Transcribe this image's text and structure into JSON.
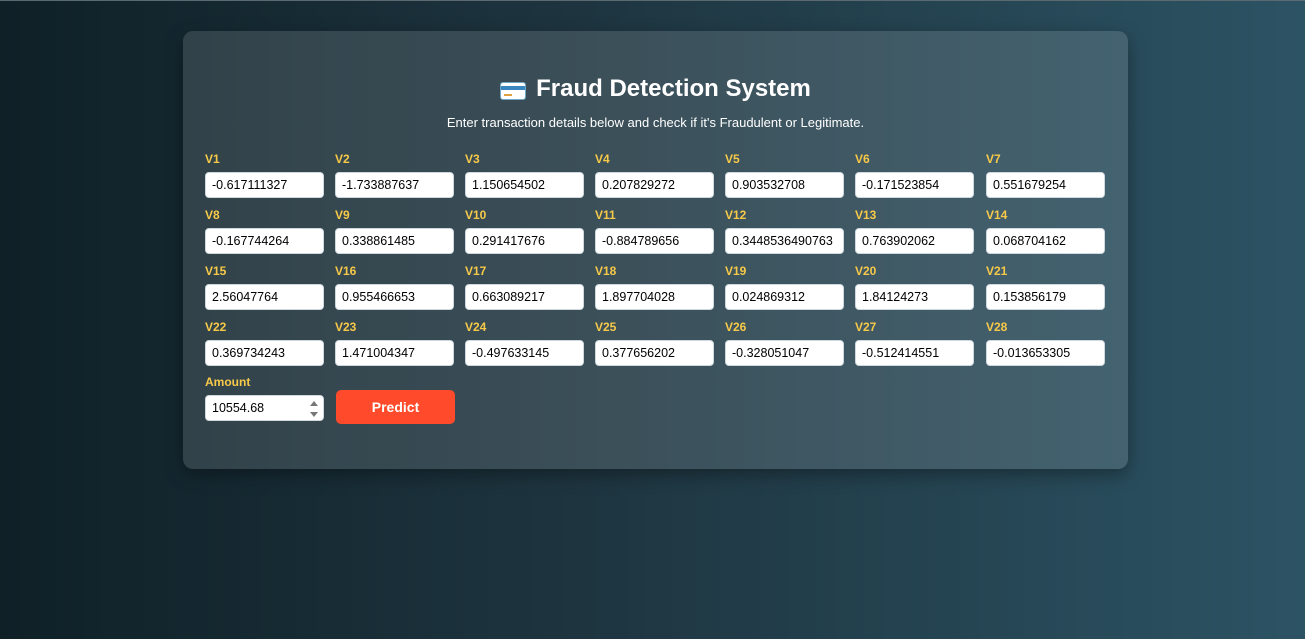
{
  "header": {
    "title": "Fraud Detection System",
    "icon": "credit-card-icon",
    "subtitle": "Enter transaction details below and check if it's Fraudulent or Legitimate."
  },
  "features": [
    {
      "label": "V1",
      "value": "-0.617111327"
    },
    {
      "label": "V2",
      "value": "-1.733887637"
    },
    {
      "label": "V3",
      "value": "1.150654502"
    },
    {
      "label": "V4",
      "value": "0.207829272"
    },
    {
      "label": "V5",
      "value": "0.903532708"
    },
    {
      "label": "V6",
      "value": "-0.171523854"
    },
    {
      "label": "V7",
      "value": "0.551679254"
    },
    {
      "label": "V8",
      "value": "-0.167744264"
    },
    {
      "label": "V9",
      "value": "0.338861485"
    },
    {
      "label": "V10",
      "value": "0.291417676"
    },
    {
      "label": "V11",
      "value": "-0.884789656"
    },
    {
      "label": "V12",
      "value": "0.3448536490763"
    },
    {
      "label": "V13",
      "value": "0.763902062"
    },
    {
      "label": "V14",
      "value": "0.068704162"
    },
    {
      "label": "V15",
      "value": "2.56047764"
    },
    {
      "label": "V16",
      "value": "0.955466653"
    },
    {
      "label": "V17",
      "value": "0.663089217"
    },
    {
      "label": "V18",
      "value": "1.897704028"
    },
    {
      "label": "V19",
      "value": "0.024869312"
    },
    {
      "label": "V20",
      "value": "1.84124273"
    },
    {
      "label": "V21",
      "value": "0.153856179"
    },
    {
      "label": "V22",
      "value": "0.369734243"
    },
    {
      "label": "V23",
      "value": "1.471004347"
    },
    {
      "label": "V24",
      "value": "-0.497633145"
    },
    {
      "label": "V25",
      "value": "0.377656202"
    },
    {
      "label": "V26",
      "value": "-0.328051047"
    },
    {
      "label": "V27",
      "value": "-0.512414551"
    },
    {
      "label": "V28",
      "value": "-0.013653305"
    }
  ],
  "amount": {
    "label": "Amount",
    "value": "10554.68"
  },
  "predict_label": "Predict",
  "colors": {
    "label": "#f7c948",
    "button": "#ff4b2b",
    "text": "#ffffff"
  }
}
